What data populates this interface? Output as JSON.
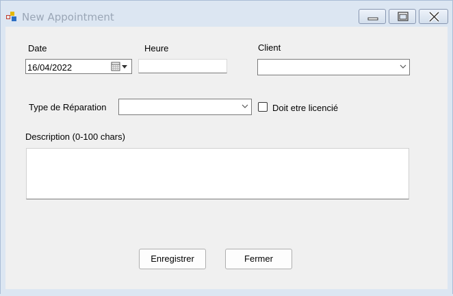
{
  "window": {
    "title": "New Appointment"
  },
  "form": {
    "date_label": "Date",
    "date_value": "16/04/2022",
    "heure_label": "Heure",
    "heure_value": "",
    "client_label": "Client",
    "client_value": "",
    "type_label": "Type de Réparation",
    "type_value": "",
    "licence_label": "Doit etre licencié",
    "licence_checked": false,
    "description_label": "Description (0-100 chars)",
    "description_value": ""
  },
  "buttons": {
    "save_label": "Enregistrer",
    "close_label": "Fermer"
  },
  "icons": {
    "app": "app-icon",
    "minimize": "minimize-icon",
    "maximize": "maximize-icon",
    "close": "close-icon",
    "calendar": "calendar-icon",
    "dropdown": "chevron-down-icon"
  }
}
